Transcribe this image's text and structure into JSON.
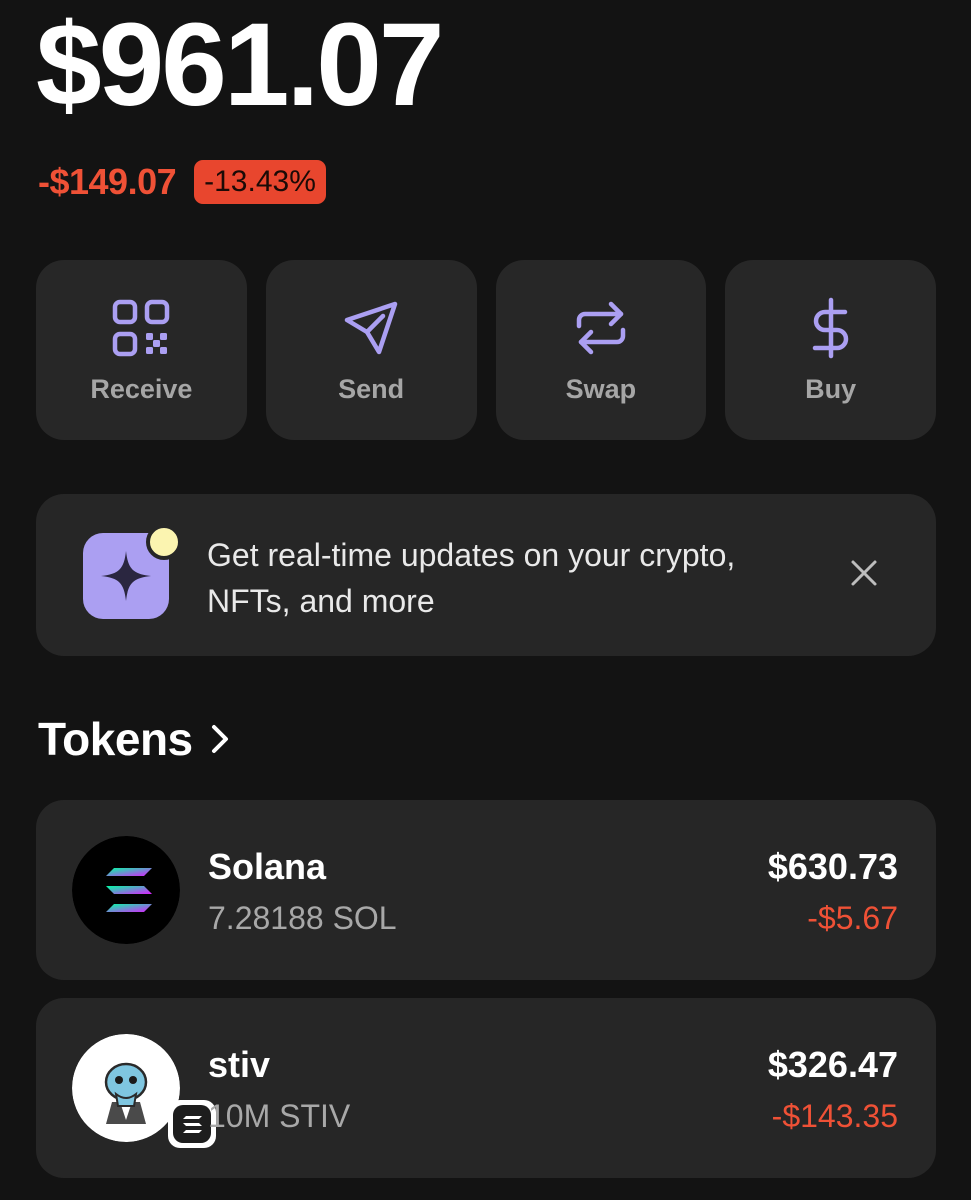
{
  "balance": {
    "total": "$961.07",
    "change_amount": "-$149.07",
    "change_percent": "-13.43%"
  },
  "actions": [
    {
      "label": "Receive",
      "icon": "qr-code-icon"
    },
    {
      "label": "Send",
      "icon": "send-icon"
    },
    {
      "label": "Swap",
      "icon": "swap-icon"
    },
    {
      "label": "Buy",
      "icon": "dollar-icon"
    }
  ],
  "banner": {
    "text": "Get real-time updates on your crypto, NFTs, and more",
    "icon": "sparkle-icon",
    "close_icon": "close-icon"
  },
  "tokens_section": {
    "title": "Tokens",
    "chevron_icon": "chevron-right-icon"
  },
  "tokens": [
    {
      "name": "Solana",
      "amount": "7.28188 SOL",
      "value": "$630.73",
      "change": "-$5.67",
      "icon": "solana-logo-icon"
    },
    {
      "name": "stiv",
      "amount": "10M STIV",
      "value": "$326.47",
      "change": "-$143.35",
      "icon": "stiv-token-icon"
    }
  ],
  "colors": {
    "background": "#131313",
    "card": "#262626",
    "accent": "#ab9ff2",
    "negative": "#ef5136",
    "negative_badge": "#e8462e",
    "notification_dot": "#fbf4b0"
  }
}
